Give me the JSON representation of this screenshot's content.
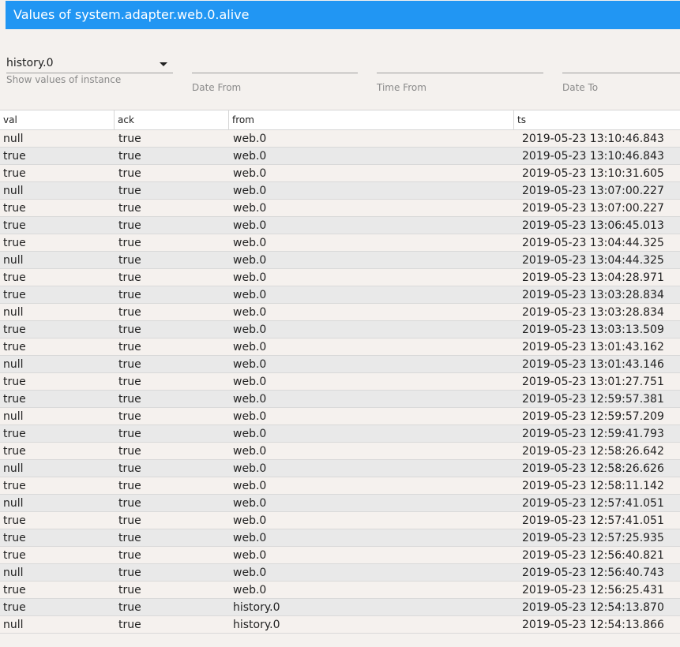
{
  "window": {
    "title": "Values of system.adapter.web.0.alive"
  },
  "filters": {
    "instance": {
      "value": "history.0",
      "helper": "Show values of instance"
    },
    "date_from": {
      "label": "Date From"
    },
    "time_from": {
      "label": "Time From"
    },
    "date_to": {
      "label": "Date To"
    }
  },
  "table": {
    "columns": [
      "val",
      "ack",
      "from",
      "ts"
    ],
    "rows": [
      [
        "null",
        "true",
        "web.0",
        "2019-05-23 13:10:46.843"
      ],
      [
        "true",
        "true",
        "web.0",
        "2019-05-23 13:10:46.843"
      ],
      [
        "true",
        "true",
        "web.0",
        "2019-05-23 13:10:31.605"
      ],
      [
        "null",
        "true",
        "web.0",
        "2019-05-23 13:07:00.227"
      ],
      [
        "true",
        "true",
        "web.0",
        "2019-05-23 13:07:00.227"
      ],
      [
        "true",
        "true",
        "web.0",
        "2019-05-23 13:06:45.013"
      ],
      [
        "true",
        "true",
        "web.0",
        "2019-05-23 13:04:44.325"
      ],
      [
        "null",
        "true",
        "web.0",
        "2019-05-23 13:04:44.325"
      ],
      [
        "true",
        "true",
        "web.0",
        "2019-05-23 13:04:28.971"
      ],
      [
        "true",
        "true",
        "web.0",
        "2019-05-23 13:03:28.834"
      ],
      [
        "null",
        "true",
        "web.0",
        "2019-05-23 13:03:28.834"
      ],
      [
        "true",
        "true",
        "web.0",
        "2019-05-23 13:03:13.509"
      ],
      [
        "true",
        "true",
        "web.0",
        "2019-05-23 13:01:43.162"
      ],
      [
        "null",
        "true",
        "web.0",
        "2019-05-23 13:01:43.146"
      ],
      [
        "true",
        "true",
        "web.0",
        "2019-05-23 13:01:27.751"
      ],
      [
        "true",
        "true",
        "web.0",
        "2019-05-23 12:59:57.381"
      ],
      [
        "null",
        "true",
        "web.0",
        "2019-05-23 12:59:57.209"
      ],
      [
        "true",
        "true",
        "web.0",
        "2019-05-23 12:59:41.793"
      ],
      [
        "true",
        "true",
        "web.0",
        "2019-05-23 12:58:26.642"
      ],
      [
        "null",
        "true",
        "web.0",
        "2019-05-23 12:58:26.626"
      ],
      [
        "true",
        "true",
        "web.0",
        "2019-05-23 12:58:11.142"
      ],
      [
        "null",
        "true",
        "web.0",
        "2019-05-23 12:57:41.051"
      ],
      [
        "true",
        "true",
        "web.0",
        "2019-05-23 12:57:41.051"
      ],
      [
        "true",
        "true",
        "web.0",
        "2019-05-23 12:57:25.935"
      ],
      [
        "true",
        "true",
        "web.0",
        "2019-05-23 12:56:40.821"
      ],
      [
        "null",
        "true",
        "web.0",
        "2019-05-23 12:56:40.743"
      ],
      [
        "true",
        "true",
        "web.0",
        "2019-05-23 12:56:25.431"
      ],
      [
        "true",
        "true",
        "history.0",
        "2019-05-23 12:54:13.870"
      ],
      [
        "null",
        "true",
        "history.0",
        "2019-05-23 12:54:13.866"
      ]
    ]
  },
  "colors": {
    "accent": "#2196f3",
    "background": "#f4f1ee"
  }
}
